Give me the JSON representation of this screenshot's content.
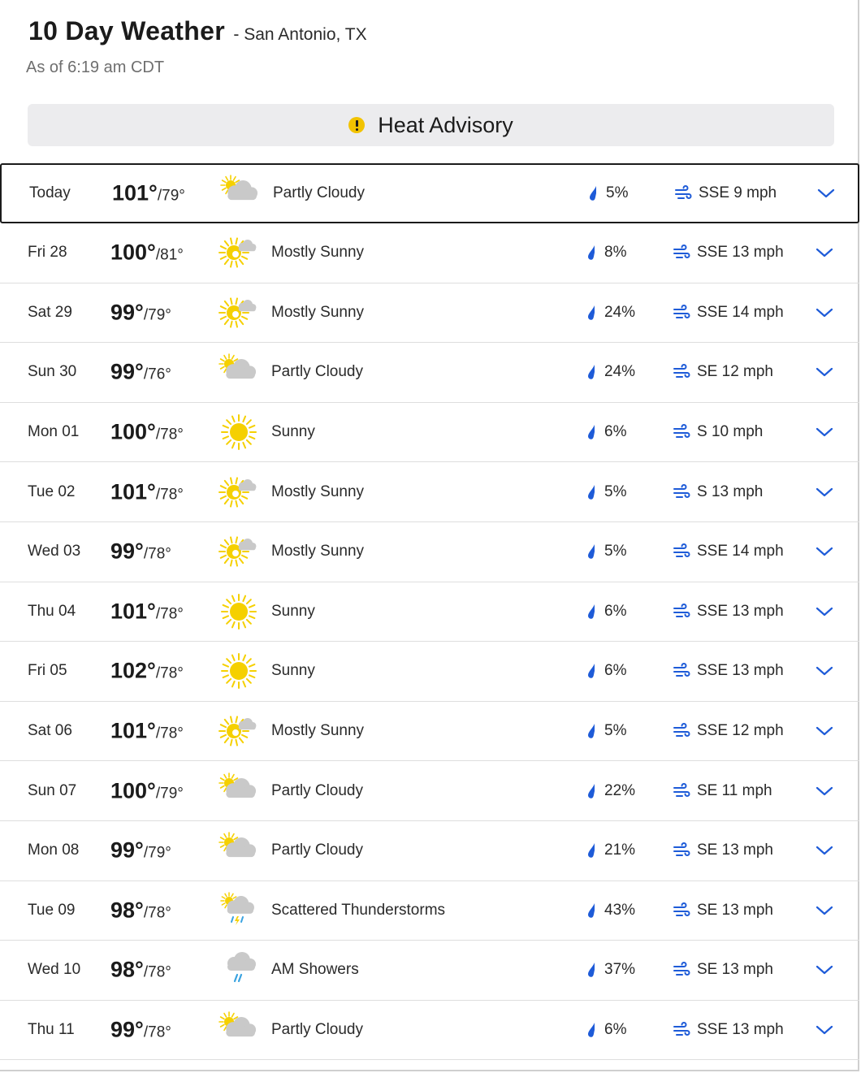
{
  "header": {
    "title": "10 Day Weather",
    "location": "- San Antonio, TX",
    "as_of": "As of 6:19 am CDT"
  },
  "advisory": {
    "label": "Heat Advisory",
    "icon": "warning-icon",
    "color": "#f2c300"
  },
  "colors": {
    "accent": "#1e5bd8",
    "sun": "#f5d000",
    "cloud": "#c9c9c9",
    "rain": "#3aa3e0"
  },
  "days": [
    {
      "day": "Today",
      "hi": "101°",
      "lo": "/79°",
      "icon": "partly-cloudy",
      "cond": "Partly Cloudy",
      "precip": "5%",
      "wind": "SSE 9 mph"
    },
    {
      "day": "Fri 28",
      "hi": "100°",
      "lo": "/81°",
      "icon": "mostly-sunny",
      "cond": "Mostly Sunny",
      "precip": "8%",
      "wind": "SSE 13 mph"
    },
    {
      "day": "Sat 29",
      "hi": "99°",
      "lo": "/79°",
      "icon": "mostly-sunny",
      "cond": "Mostly Sunny",
      "precip": "24%",
      "wind": "SSE 14 mph"
    },
    {
      "day": "Sun 30",
      "hi": "99°",
      "lo": "/76°",
      "icon": "partly-cloudy",
      "cond": "Partly Cloudy",
      "precip": "24%",
      "wind": "SE 12 mph"
    },
    {
      "day": "Mon 01",
      "hi": "100°",
      "lo": "/78°",
      "icon": "sunny",
      "cond": "Sunny",
      "precip": "6%",
      "wind": "S 10 mph"
    },
    {
      "day": "Tue 02",
      "hi": "101°",
      "lo": "/78°",
      "icon": "mostly-sunny",
      "cond": "Mostly Sunny",
      "precip": "5%",
      "wind": "S 13 mph"
    },
    {
      "day": "Wed 03",
      "hi": "99°",
      "lo": "/78°",
      "icon": "mostly-sunny",
      "cond": "Mostly Sunny",
      "precip": "5%",
      "wind": "SSE 14 mph"
    },
    {
      "day": "Thu 04",
      "hi": "101°",
      "lo": "/78°",
      "icon": "sunny",
      "cond": "Sunny",
      "precip": "6%",
      "wind": "SSE 13 mph"
    },
    {
      "day": "Fri 05",
      "hi": "102°",
      "lo": "/78°",
      "icon": "sunny",
      "cond": "Sunny",
      "precip": "6%",
      "wind": "SSE 13 mph"
    },
    {
      "day": "Sat 06",
      "hi": "101°",
      "lo": "/78°",
      "icon": "mostly-sunny",
      "cond": "Mostly Sunny",
      "precip": "5%",
      "wind": "SSE 12 mph"
    },
    {
      "day": "Sun 07",
      "hi": "100°",
      "lo": "/79°",
      "icon": "partly-cloudy",
      "cond": "Partly Cloudy",
      "precip": "22%",
      "wind": "SE 11 mph"
    },
    {
      "day": "Mon 08",
      "hi": "99°",
      "lo": "/79°",
      "icon": "partly-cloudy",
      "cond": "Partly Cloudy",
      "precip": "21%",
      "wind": "SE 13 mph"
    },
    {
      "day": "Tue 09",
      "hi": "98°",
      "lo": "/78°",
      "icon": "scattered-thunderstorms",
      "cond": "Scattered Thunderstorms",
      "precip": "43%",
      "wind": "SE 13 mph"
    },
    {
      "day": "Wed 10",
      "hi": "98°",
      "lo": "/78°",
      "icon": "am-showers",
      "cond": "AM Showers",
      "precip": "37%",
      "wind": "SE 13 mph"
    },
    {
      "day": "Thu 11",
      "hi": "99°",
      "lo": "/78°",
      "icon": "partly-cloudy",
      "cond": "Partly Cloudy",
      "precip": "6%",
      "wind": "SSE 13 mph"
    }
  ]
}
